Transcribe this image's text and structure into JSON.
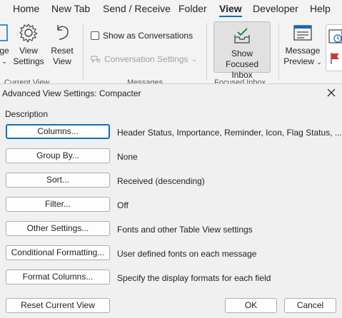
{
  "ribbon": {
    "tabs": [
      {
        "label": "Home"
      },
      {
        "label": "New Tab"
      },
      {
        "label": "Send / Receive"
      },
      {
        "label": "Folder"
      },
      {
        "label": "View",
        "active": true
      },
      {
        "label": "Developer"
      },
      {
        "label": "Help"
      }
    ],
    "change_view_partial": "ge",
    "view_settings_line1": "View",
    "view_settings_line2": "Settings",
    "reset_view_line1": "Reset",
    "reset_view_line2": "View",
    "current_view_group": "Current View",
    "show_as_conversations": "Show as Conversations",
    "conversation_settings": "Conversation Settings",
    "messages_group": "Messages",
    "show_focused_line1": "Show",
    "show_focused_line2": "Focused Inbox",
    "focused_inbox_group": "Focused Inbox",
    "message_preview_line1": "Message",
    "message_preview_line2": "Preview",
    "accent_color": "#0f6cbd"
  },
  "dialog": {
    "title": "Advanced View Settings: Compacter",
    "group_label": "Description",
    "rows": [
      {
        "button": "Columns...",
        "description": "Header Status, Importance, Reminder, Icon, Flag Status, ..."
      },
      {
        "button": "Group By...",
        "description": "None"
      },
      {
        "button": "Sort...",
        "description": "Received (descending)"
      },
      {
        "button": "Filter...",
        "description": "Off"
      },
      {
        "button": "Other Settings...",
        "description": "Fonts and other Table View settings"
      },
      {
        "button": "Conditional Formatting...",
        "description": "User defined fonts on each message"
      },
      {
        "button": "Format Columns...",
        "description": "Specify the display formats for each field"
      }
    ],
    "reset_label": "Reset Current View",
    "ok_label": "OK",
    "cancel_label": "Cancel"
  }
}
